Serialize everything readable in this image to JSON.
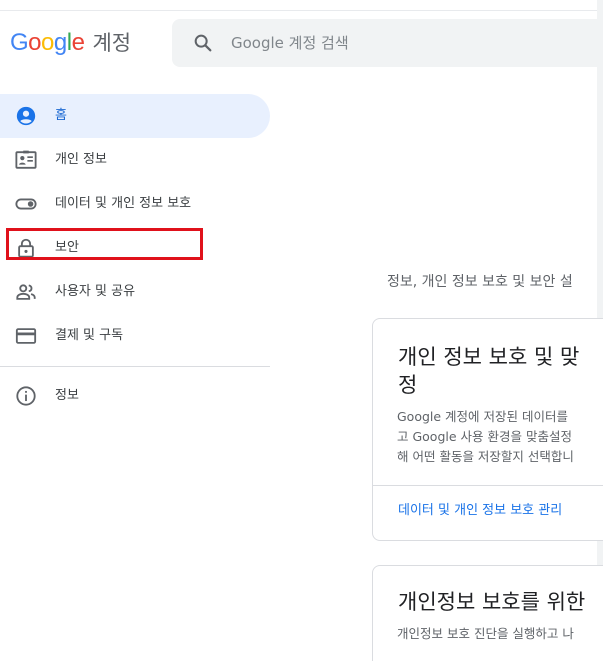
{
  "header": {
    "logo_letters": [
      {
        "char": "G",
        "color": "#4285F4"
      },
      {
        "char": "o",
        "color": "#EA4335"
      },
      {
        "char": "o",
        "color": "#FBBC05"
      },
      {
        "char": "g",
        "color": "#4285F4"
      },
      {
        "char": "l",
        "color": "#34A853"
      },
      {
        "char": "e",
        "color": "#EA4335"
      }
    ],
    "product_name": "계정",
    "search": {
      "placeholder": "Google 계정 검색",
      "icon": "search-icon"
    }
  },
  "sidebar": {
    "items": [
      {
        "label": "홈",
        "icon": "account-circle-icon",
        "active": true
      },
      {
        "label": "개인 정보",
        "icon": "id-card-icon",
        "active": false
      },
      {
        "label": "데이터 및 개인 정보 보호",
        "icon": "toggle-icon",
        "active": false
      },
      {
        "label": "보안",
        "icon": "lock-icon",
        "active": false,
        "highlighted": true
      },
      {
        "label": "사용자 및 공유",
        "icon": "people-icon",
        "active": false
      },
      {
        "label": "결제 및 구독",
        "icon": "credit-card-icon",
        "active": false
      }
    ],
    "info_item": {
      "label": "정보",
      "icon": "info-icon"
    }
  },
  "main": {
    "intro_text": "정보, 개인 정보 보호 및 보안 설",
    "privacy_card": {
      "title_line1": "개인 정보 보호 및 맞",
      "title_line2": "정",
      "body_lines": [
        "Google 계정에 저장된 데이터를",
        "고 Google 사용 환경을 맞춤설정",
        "해 어떤 활동을 저장할지 선택합니"
      ],
      "link": "데이터 및 개인 정보 보호 관리"
    },
    "checkup_card": {
      "title": "개인정보 보호를 위한",
      "body": "개인정보 보호 진단을 실행하고 나"
    }
  },
  "colors": {
    "accent": "#1a73e8",
    "active_bg": "#e8f0fe",
    "active_text": "#1967d2",
    "highlight": "#e0111b"
  }
}
